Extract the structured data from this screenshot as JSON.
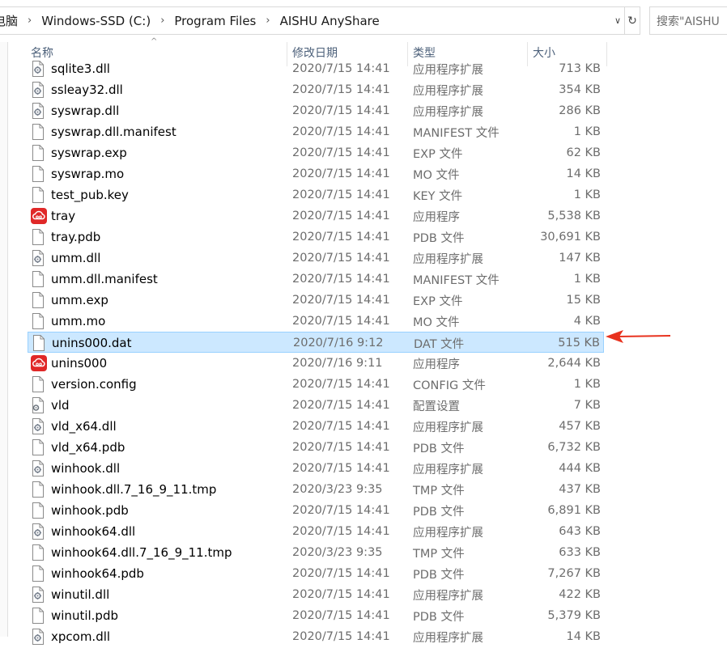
{
  "address": {
    "crumbs": [
      "电脑",
      "Windows-SSD (C:)",
      "Program Files",
      "AISHU AnyShare"
    ],
    "separator": "›",
    "dropdown": "∨",
    "refresh": "↻"
  },
  "search": {
    "text": "搜索\"AISHU"
  },
  "columns": {
    "sort_indicator": "^",
    "name": "名称",
    "date": "修改日期",
    "type": "类型",
    "size": "大小"
  },
  "files": [
    {
      "name": "sqlite3.dll",
      "date": "2020/7/15 14:41",
      "type": "应用程序扩展",
      "size": "713 KB",
      "icon": "dll-icon"
    },
    {
      "name": "ssleay32.dll",
      "date": "2020/7/15 14:41",
      "type": "应用程序扩展",
      "size": "354 KB",
      "icon": "dll-icon"
    },
    {
      "name": "syswrap.dll",
      "date": "2020/7/15 14:41",
      "type": "应用程序扩展",
      "size": "286 KB",
      "icon": "dll-icon"
    },
    {
      "name": "syswrap.dll.manifest",
      "date": "2020/7/15 14:41",
      "type": "MANIFEST 文件",
      "size": "1 KB",
      "icon": "file-icon"
    },
    {
      "name": "syswrap.exp",
      "date": "2020/7/15 14:41",
      "type": "EXP 文件",
      "size": "62 KB",
      "icon": "file-icon"
    },
    {
      "name": "syswrap.mo",
      "date": "2020/7/15 14:41",
      "type": "MO 文件",
      "size": "14 KB",
      "icon": "file-icon"
    },
    {
      "name": "test_pub.key",
      "date": "2020/7/15 14:41",
      "type": "KEY 文件",
      "size": "1 KB",
      "icon": "file-icon"
    },
    {
      "name": "tray",
      "date": "2020/7/15 14:41",
      "type": "应用程序",
      "size": "5,538 KB",
      "icon": "anyshare-app-icon"
    },
    {
      "name": "tray.pdb",
      "date": "2020/7/15 14:41",
      "type": "PDB 文件",
      "size": "30,691 KB",
      "icon": "file-icon"
    },
    {
      "name": "umm.dll",
      "date": "2020/7/15 14:41",
      "type": "应用程序扩展",
      "size": "147 KB",
      "icon": "dll-icon"
    },
    {
      "name": "umm.dll.manifest",
      "date": "2020/7/15 14:41",
      "type": "MANIFEST 文件",
      "size": "1 KB",
      "icon": "file-icon"
    },
    {
      "name": "umm.exp",
      "date": "2020/7/15 14:41",
      "type": "EXP 文件",
      "size": "15 KB",
      "icon": "file-icon"
    },
    {
      "name": "umm.mo",
      "date": "2020/7/15 14:41",
      "type": "MO 文件",
      "size": "4 KB",
      "icon": "file-icon"
    },
    {
      "name": "unins000.dat",
      "date": "2020/7/16 9:12",
      "type": "DAT 文件",
      "size": "515 KB",
      "icon": "file-icon",
      "selected": true
    },
    {
      "name": "unins000",
      "date": "2020/7/16 9:11",
      "type": "应用程序",
      "size": "2,644 KB",
      "icon": "anyshare-app-icon"
    },
    {
      "name": "version.config",
      "date": "2020/7/15 14:41",
      "type": "CONFIG 文件",
      "size": "1 KB",
      "icon": "file-icon"
    },
    {
      "name": "vld",
      "date": "2020/7/15 14:41",
      "type": "配置设置",
      "size": "7 KB",
      "icon": "settings-file-icon"
    },
    {
      "name": "vld_x64.dll",
      "date": "2020/7/15 14:41",
      "type": "应用程序扩展",
      "size": "457 KB",
      "icon": "dll-icon"
    },
    {
      "name": "vld_x64.pdb",
      "date": "2020/7/15 14:41",
      "type": "PDB 文件",
      "size": "6,732 KB",
      "icon": "file-icon"
    },
    {
      "name": "winhook.dll",
      "date": "2020/7/15 14:41",
      "type": "应用程序扩展",
      "size": "444 KB",
      "icon": "dll-icon"
    },
    {
      "name": "winhook.dll.7_16_9_11.tmp",
      "date": "2020/3/23 9:35",
      "type": "TMP 文件",
      "size": "437 KB",
      "icon": "file-icon"
    },
    {
      "name": "winhook.pdb",
      "date": "2020/7/15 14:41",
      "type": "PDB 文件",
      "size": "6,891 KB",
      "icon": "file-icon"
    },
    {
      "name": "winhook64.dll",
      "date": "2020/7/15 14:41",
      "type": "应用程序扩展",
      "size": "643 KB",
      "icon": "dll-icon"
    },
    {
      "name": "winhook64.dll.7_16_9_11.tmp",
      "date": "2020/3/23 9:35",
      "type": "TMP 文件",
      "size": "633 KB",
      "icon": "file-icon"
    },
    {
      "name": "winhook64.pdb",
      "date": "2020/7/15 14:41",
      "type": "PDB 文件",
      "size": "7,267 KB",
      "icon": "file-icon"
    },
    {
      "name": "winutil.dll",
      "date": "2020/7/15 14:41",
      "type": "应用程序扩展",
      "size": "422 KB",
      "icon": "dll-icon"
    },
    {
      "name": "winutil.pdb",
      "date": "2020/7/15 14:41",
      "type": "PDB 文件",
      "size": "5,379 KB",
      "icon": "file-icon"
    },
    {
      "name": "xpcom.dll",
      "date": "2020/7/15 14:41",
      "type": "应用程序扩展",
      "size": "14 KB",
      "icon": "dll-icon"
    }
  ],
  "colors": {
    "selection_bg": "#cce8ff",
    "selection_border": "#99d1ff",
    "header_text": "#4c607a",
    "secondary_text": "#6d6d6d",
    "arrow": "#e8321e",
    "app_icon": "#e02828"
  }
}
